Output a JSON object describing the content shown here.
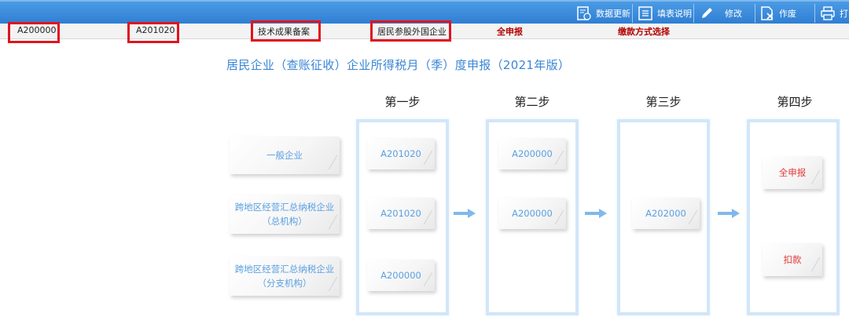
{
  "toolbar": {
    "items": [
      {
        "label": "数据更新",
        "icon": "data-refresh-icon"
      },
      {
        "label": "填表说明",
        "icon": "form-instructions-icon"
      },
      {
        "label": "修改",
        "icon": "pencil-icon"
      },
      {
        "label": "作废",
        "icon": "void-document-icon"
      },
      {
        "label": "打",
        "icon": "print-icon"
      }
    ]
  },
  "subbar": {
    "items": [
      "A200000",
      "A201020",
      "技术成果备案",
      "居民参股外国企业",
      "全申报",
      "缴款方式选择"
    ]
  },
  "main": {
    "title": "居民企业（查账征收）企业所得税月（季）度申报（2021年版）",
    "steps": [
      "第一步",
      "第二步",
      "第三步",
      "第四步"
    ],
    "left_boxes": [
      "一般企业",
      "跨地区经营汇总纳税企业\n（总机构）",
      "跨地区经营汇总纳税企业\n（分支机构）"
    ],
    "step1_boxes": [
      "A201020",
      "A201020",
      "A200000"
    ],
    "step2_boxes": [
      "A200000",
      "A200000"
    ],
    "step3_boxes": [
      "A202000"
    ],
    "step4_boxes": [
      "全申报",
      "扣款"
    ]
  },
  "colors": {
    "toolbar_blue": "#3a8cdc",
    "title_blue": "#3a86d4",
    "highlight_red": "#e0141e",
    "step4_text_red": "#e23a3a"
  }
}
